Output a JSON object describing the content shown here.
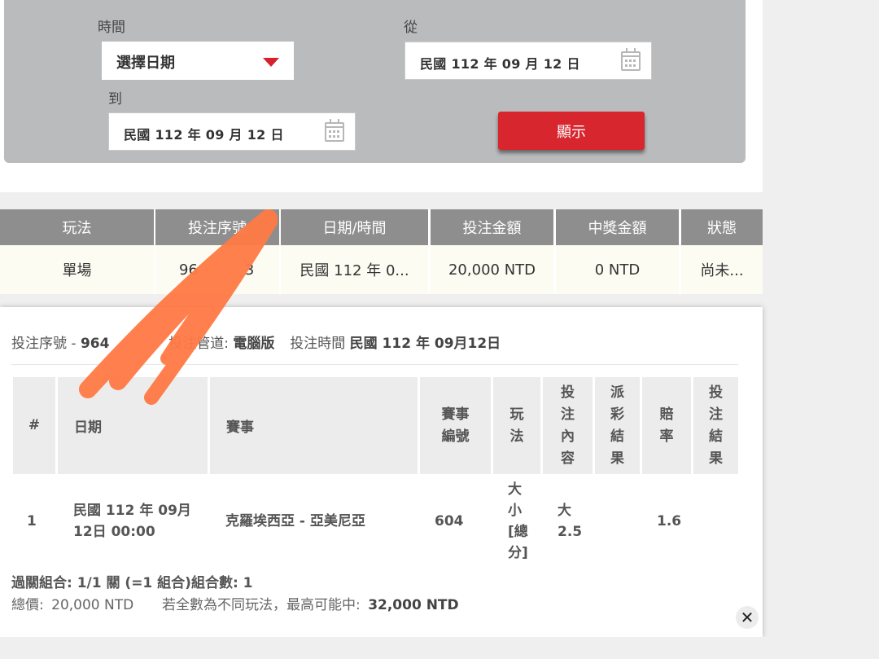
{
  "filter": {
    "time_label": "時間",
    "time_select_value": "選擇日期",
    "from_label": "從",
    "from_value": "民國 112 年 09 月 12 日",
    "to_label": "到",
    "to_value": "民國 112 年 09 月 12 日",
    "show_button": "顯示",
    "calendar_icon": "calendar-icon",
    "accent_color": "#d7262e"
  },
  "summary": {
    "headers": [
      "玩法",
      "投注序號",
      "日期/時間",
      "投注金額",
      "中獎金額",
      "狀態"
    ],
    "row": [
      "單場",
      "96",
      "民國 112 年 0...",
      "20,000 NTD",
      "0 NTD",
      "尚未..."
    ],
    "row_serial_tail": "3"
  },
  "detail": {
    "serial_label": "投注序號",
    "serial_value": "964",
    "channel_label": "投注管道:",
    "channel_value": "電腦版",
    "bet_time_label": "投注時間",
    "bet_time_value": "民國 112 年 09月12日",
    "columns": {
      "index": "#",
      "date": "日期",
      "event": "賽事",
      "event_no": "賽事編號",
      "play": "玩法",
      "bet_content": "投注內容",
      "payout": "派彩結果",
      "odds": "賠率",
      "result": "投注結果"
    },
    "row": {
      "index": "1",
      "date": "民國 112 年 09月 12日 00:00",
      "event": "克羅埃西亞 - 亞美尼亞",
      "event_no": "604",
      "play": "大小[總分]",
      "bet_content": "大 2.5",
      "payout": "",
      "odds": "1.6",
      "result": ""
    },
    "parlay_line": "過關組合: 1/1 關 (=1 組合)組合數: 1",
    "total_label": "總價:",
    "total_value": "20,000 NTD",
    "max_label": "若全數為不同玩法，最高可能中:",
    "max_value": "32,000 NTD",
    "close_icon": "close-icon"
  }
}
